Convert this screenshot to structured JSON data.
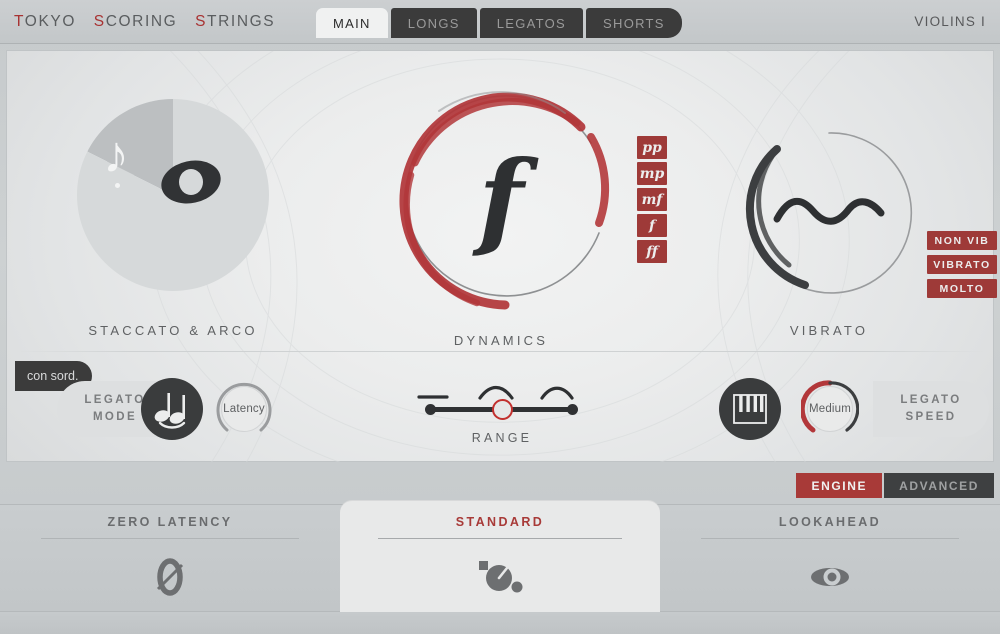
{
  "header": {
    "logo_parts": [
      {
        "red": "T",
        "rest": "OKYO"
      },
      {
        "red": "S",
        "rest": "CORING"
      },
      {
        "red": "S",
        "rest": "TRINGS"
      }
    ],
    "logo_full": "TOKYO SCORING STRINGS",
    "tabs": [
      {
        "label": "MAIN",
        "active": true
      },
      {
        "label": "LONGS",
        "active": false
      },
      {
        "label": "LEGATOS",
        "active": false
      },
      {
        "label": "SHORTS",
        "active": false
      }
    ],
    "preset": "VIOLINS I"
  },
  "articulation": {
    "label": "STACCATO & ARCO",
    "con_sord_label": "con sord.",
    "note_icon": "eighth-note-icon",
    "whole_note_icon": "whole-note-icon"
  },
  "dynamics": {
    "label": "DYNAMICS",
    "current_glyph": "f",
    "buttons": [
      {
        "label": "pp"
      },
      {
        "label": "mp"
      },
      {
        "label": "mf"
      },
      {
        "label": "f"
      },
      {
        "label": "ff"
      }
    ]
  },
  "vibrato": {
    "label": "VIBRATO",
    "wave_icon": "wave-icon",
    "buttons": [
      {
        "label": "NON VIB"
      },
      {
        "label": "VIBRATO"
      },
      {
        "label": "MOLTO"
      }
    ]
  },
  "legato_mode": {
    "label": "LEGATO\nMODE",
    "label_line1": "LEGATO",
    "label_line2": "MODE",
    "icon": "slurred-notes-icon",
    "knob_value": "Latency"
  },
  "range": {
    "label": "RANGE",
    "position": 2,
    "positions": 3,
    "marks": [
      "flat-line",
      "small-arc",
      "large-arc"
    ]
  },
  "legato_speed": {
    "label_line1": "LEGATO",
    "label_line2": "SPEED",
    "icon": "piano-keys-icon",
    "knob_value": "Medium"
  },
  "engine": {
    "tabs": [
      {
        "label": "ENGINE",
        "active": true
      },
      {
        "label": "ADVANCED",
        "active": false
      }
    ],
    "options": [
      {
        "label": "ZERO LATENCY",
        "icon": "slashed-zero-icon",
        "selected": false
      },
      {
        "label": "STANDARD",
        "icon": "metronome-icon",
        "selected": true
      },
      {
        "label": "LOOKAHEAD",
        "icon": "eye-icon",
        "selected": false
      }
    ]
  },
  "colors": {
    "accent_red": "#a83a38",
    "button_red": "#9e3a38",
    "dark": "#3a3c3d",
    "bg": "#c9cdcf",
    "panel": "#eceded",
    "text": "#5f6163"
  }
}
